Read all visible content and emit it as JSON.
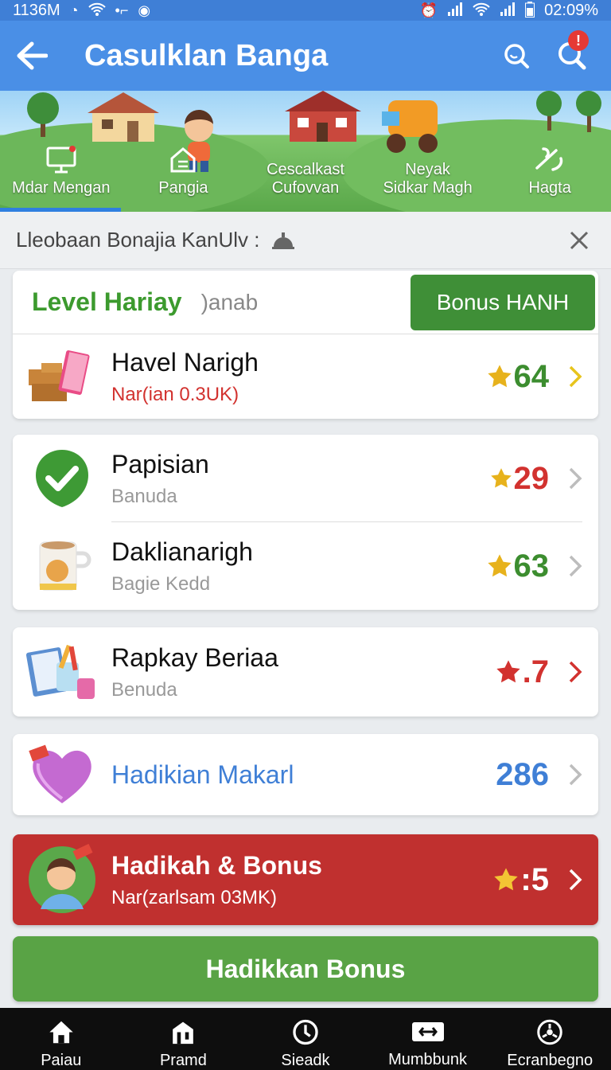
{
  "status_bar": {
    "left_text": "1136M",
    "time": "02:09%"
  },
  "app_bar": {
    "title": "Casulklan Banga"
  },
  "nav_tabs": [
    {
      "label": "Mdar Mengan",
      "icon": "monitor-icon",
      "active": true
    },
    {
      "label": "Pangia",
      "icon": "home-doc-icon",
      "active": false
    },
    {
      "label": "Cescalkast\nCufovvan",
      "icon": "arrow-icon",
      "active": false
    },
    {
      "label": "Neyak\nSidkar Magh",
      "icon": "cart-icon",
      "active": false
    },
    {
      "label": "Hagta",
      "icon": "tool-icon",
      "active": false
    }
  ],
  "banner": {
    "text": "Lleobaan Bonajia KanUlv :"
  },
  "level": {
    "title": "Level Hariay",
    "subtitle": ")anab",
    "bonus_button": "Bonus HANH"
  },
  "items": [
    {
      "title": "Havel Narigh",
      "subtitle": "Nar(ian 0.3UK)",
      "value": "64",
      "value_color": "#3c8d2f",
      "star_color": "#e7b21c",
      "chev_color": "#e7c41c",
      "subtitle_color": "#d2322f"
    },
    {
      "title": "Papisian",
      "subtitle": "Banuda",
      "value": "29",
      "value_color": "#d2322f",
      "star_color": "#e7b21c",
      "chev_color": "#bdbdbd",
      "subtitle_color": "#999999"
    },
    {
      "title": "Daklianarigh",
      "subtitle": "Bagie Kedd",
      "value": "63",
      "value_color": "#3c8d2f",
      "star_color": "#e7b21c",
      "chev_color": "#bdbdbd",
      "subtitle_color": "#999999"
    },
    {
      "title": "Rapkay Beriaa",
      "subtitle": "Benuda",
      "value": ".7",
      "value_color": "#d2322f",
      "star_color": "#d2322f",
      "chev_color": "#d2322f",
      "subtitle_color": "#999999"
    },
    {
      "title": "Hadikian Makarl",
      "subtitle": "",
      "value": "286",
      "value_color": "#3f7fd6",
      "star_color": "",
      "chev_color": "#bdbdbd",
      "subtitle_color": "#999999"
    }
  ],
  "promo": {
    "title": "Hadikah & Bonus",
    "subtitle": "Nar(zarlsam 03MK)",
    "value": ":5"
  },
  "cta": {
    "label": "Hadikkan Bonus"
  },
  "bottom_nav": [
    {
      "label": "Paiau",
      "icon": "home-icon"
    },
    {
      "label": "Pramd",
      "icon": "building-icon"
    },
    {
      "label": "Sieadk",
      "icon": "clock-icon"
    },
    {
      "label": "Mumbbunk",
      "icon": "ticket-icon"
    },
    {
      "label": "Ecranbegno",
      "icon": "settings-icon"
    }
  ]
}
